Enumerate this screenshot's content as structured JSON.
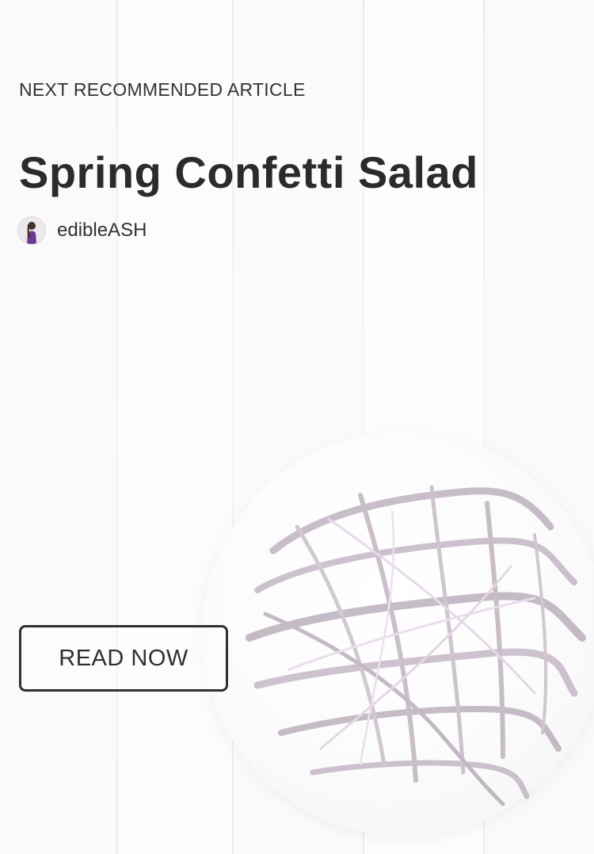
{
  "recommendation": {
    "eyebrow": "NEXT RECOMMENDED ARTICLE",
    "title": "Spring Confetti Salad",
    "author": {
      "name": "edibleASH",
      "avatar_icon": "author-avatar"
    },
    "cta_label": "READ NOW"
  },
  "colors": {
    "text": "#2f2f2f",
    "background": "#fcfcfc",
    "cabbage": "#8a5a8e"
  }
}
